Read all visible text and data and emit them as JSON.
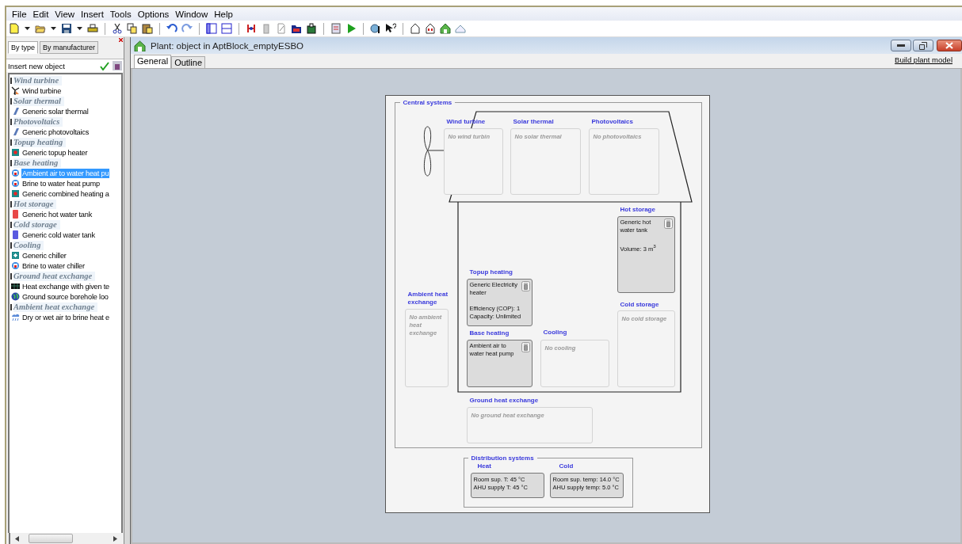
{
  "menu": [
    "File",
    "Edit",
    "View",
    "Insert",
    "Tools",
    "Options",
    "Window",
    "Help"
  ],
  "sidebar": {
    "tabs": [
      {
        "label": "By type",
        "selected": true
      },
      {
        "label": "By manufacturer",
        "selected": false
      }
    ],
    "heading": "Insert new object",
    "groups": [
      {
        "label": "Wind turbine",
        "children": [
          {
            "label": "Wind turbine",
            "selected": false
          }
        ]
      },
      {
        "label": "Solar thermal",
        "children": [
          {
            "label": "Generic solar thermal",
            "selected": false
          }
        ]
      },
      {
        "label": "Photovoltaics",
        "children": [
          {
            "label": "Generic photovoltaics",
            "selected": false
          }
        ]
      },
      {
        "label": "Topup heating",
        "children": [
          {
            "label": "Generic topup heater",
            "selected": false
          }
        ]
      },
      {
        "label": "Base heating",
        "children": [
          {
            "label": "Ambient air to water heat pu",
            "selected": true
          },
          {
            "label": "Brine to water heat pump",
            "selected": false
          },
          {
            "label": "Generic combined heating a",
            "selected": false
          }
        ]
      },
      {
        "label": "Hot storage",
        "children": [
          {
            "label": "Generic hot water tank",
            "selected": false
          }
        ]
      },
      {
        "label": "Cold storage",
        "children": [
          {
            "label": "Generic cold water tank",
            "selected": false
          }
        ]
      },
      {
        "label": "Cooling",
        "children": [
          {
            "label": "Generic chiller",
            "selected": false
          },
          {
            "label": "Brine to water chiller",
            "selected": false
          }
        ]
      },
      {
        "label": "Ground heat exchange",
        "children": [
          {
            "label": "Heat exchange with given te",
            "selected": false
          },
          {
            "label": "Ground source borehole loo",
            "selected": false
          }
        ]
      },
      {
        "label": "Ambient heat exchange",
        "children": [
          {
            "label": "Dry or wet air to brine heat e",
            "selected": false
          }
        ]
      }
    ]
  },
  "window": {
    "title": "Plant: object in AptBlock_emptyESBO",
    "tabs": [
      {
        "label": "General",
        "selected": true
      },
      {
        "label": "Outline",
        "selected": false
      }
    ],
    "link": "Build plant model"
  },
  "central_systems": {
    "title": "Central systems",
    "slots": [
      {
        "label": "Wind turbine",
        "kind": "empty",
        "text": "No wind turbin"
      },
      {
        "label": "Solar thermal",
        "kind": "empty",
        "text": "No solar thermal"
      },
      {
        "label": "Photovoltaics",
        "kind": "empty",
        "text": "No photovoltaics"
      },
      {
        "label": "Hot storage",
        "kind": "filled",
        "name": "Generic hot water tank",
        "details": [
          "Volume: 3 m$^{3}$"
        ]
      },
      {
        "label": "Topup heating",
        "kind": "filled",
        "name": "Generic Electricity heater",
        "details": [
          "Efficiency (COP): 1",
          "Capacity: Unlimited"
        ]
      },
      {
        "label": "Ambient heat exchange",
        "kind": "empty",
        "text": "No ambient heat exchange"
      },
      {
        "label": "Cold storage",
        "kind": "empty",
        "text": "No cold storage"
      },
      {
        "label": "Base heating",
        "kind": "filled",
        "name": "Ambient air to water heat pump"
      },
      {
        "label": "Cooling",
        "kind": "empty",
        "text": "No cooling"
      },
      {
        "label": "Ground heat exchange",
        "kind": "empty",
        "text": "No ground heat exchange"
      }
    ]
  },
  "distribution_systems": {
    "title": "Distribution systems",
    "parts": [
      {
        "label": "Heat",
        "lines": [
          "Room sup. T: 45 °C",
          "AHU supply T: 45 °C"
        ]
      },
      {
        "label": "Cold",
        "lines": [
          "Room sup. temp: 14.0 °C",
          "AHU supply temp: 5.0 °C"
        ]
      }
    ]
  }
}
